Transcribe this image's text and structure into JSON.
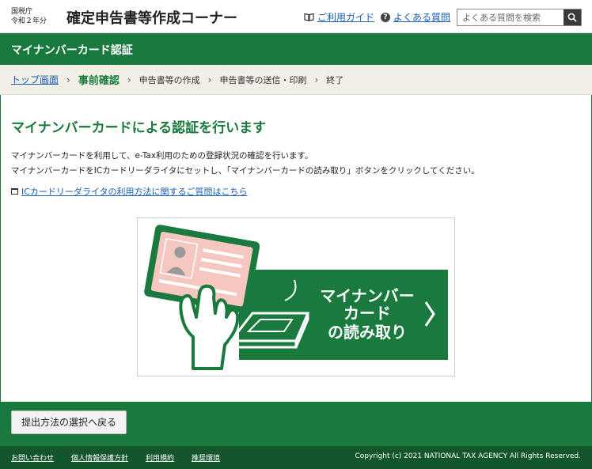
{
  "header": {
    "agency_line1": "国税庁",
    "agency_line2": "令和２年分",
    "app_title": "確定申告書等作成コーナー",
    "guide_link": "ご利用ガイド",
    "faq_link": "よくある質問",
    "search_placeholder": "よくある質問を検索"
  },
  "section": {
    "title": "マイナンバーカード認証"
  },
  "steps": {
    "items": [
      "トップ画面",
      "事前確認",
      "申告書等の作成",
      "申告書等の送信・印刷",
      "終了"
    ],
    "separator": "›"
  },
  "main": {
    "heading": "マイナンバーカードによる認証を行います",
    "desc_line1": "マイナンバーカードを利用して、e-Tax利用のための登録状況の確認を行います。",
    "desc_line2": "マイナンバーカードをICカードリーダライタにセットし、「マイナンバーカードの読み取り」ボタンをクリックしてください。",
    "help_link": "ICカードリーダライタの利用方法に関するご質問はこちら",
    "card_button": {
      "line1": "マイナンバー",
      "line2": "カード",
      "line3": "の読み取り"
    }
  },
  "actions": {
    "back_button": "提出方法の選択へ戻る"
  },
  "footer": {
    "links": [
      "お問い合わせ",
      "個人情報保護方針",
      "利用規約",
      "推奨環境"
    ],
    "copyright": "Copyright (c) 2021 NATIONAL TAX AGENCY All Rights Reserved."
  },
  "colors": {
    "brand_green": "#1a7a3e",
    "footer_green": "#14562c",
    "link_blue": "#1a5fb4",
    "step_bg": "#f1efe6"
  }
}
